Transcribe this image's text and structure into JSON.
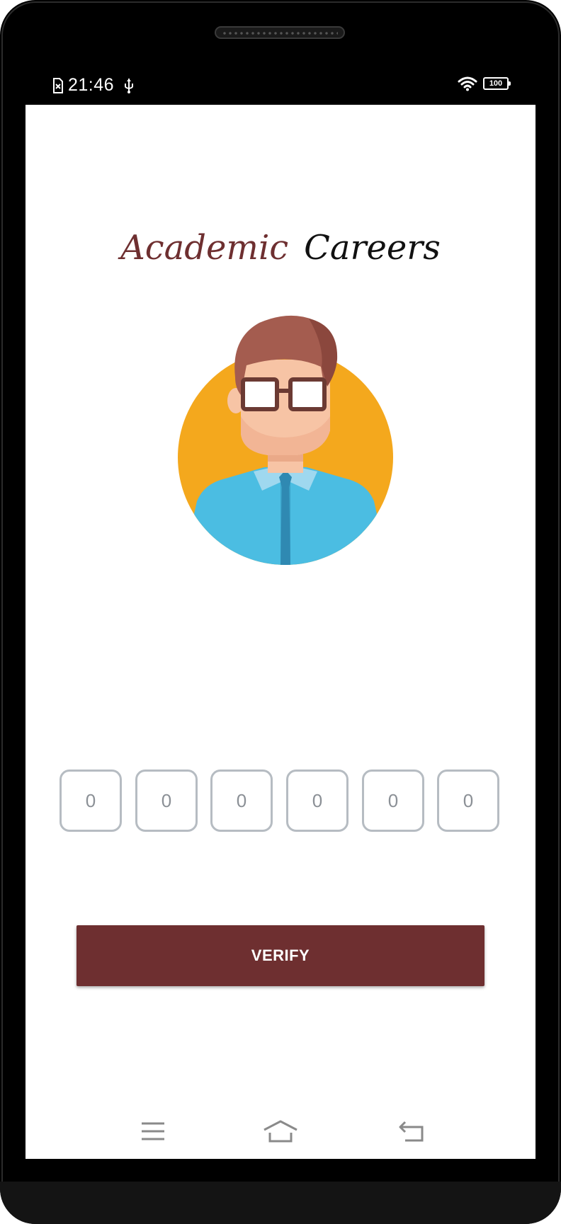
{
  "status_bar": {
    "time": "21:46",
    "battery_level": "100",
    "icons": [
      "sim-error-icon",
      "usb-icon",
      "wifi-icon",
      "battery-icon"
    ]
  },
  "app": {
    "title_part1": "Academic",
    "title_part2": "Careers",
    "title_color_part1": "#6e2f30",
    "title_color_part2": "#111111",
    "avatar_icon": "user-avatar-illustration"
  },
  "otp": {
    "digits": [
      {
        "placeholder": "0"
      },
      {
        "placeholder": "0"
      },
      {
        "placeholder": "0"
      },
      {
        "placeholder": "0"
      },
      {
        "placeholder": "0"
      },
      {
        "placeholder": "0"
      }
    ]
  },
  "verify_button": {
    "label": "VERIFY",
    "color": "#6e2f30"
  },
  "nav_bar": {
    "items": [
      "menu-icon",
      "home-icon",
      "back-icon"
    ]
  }
}
